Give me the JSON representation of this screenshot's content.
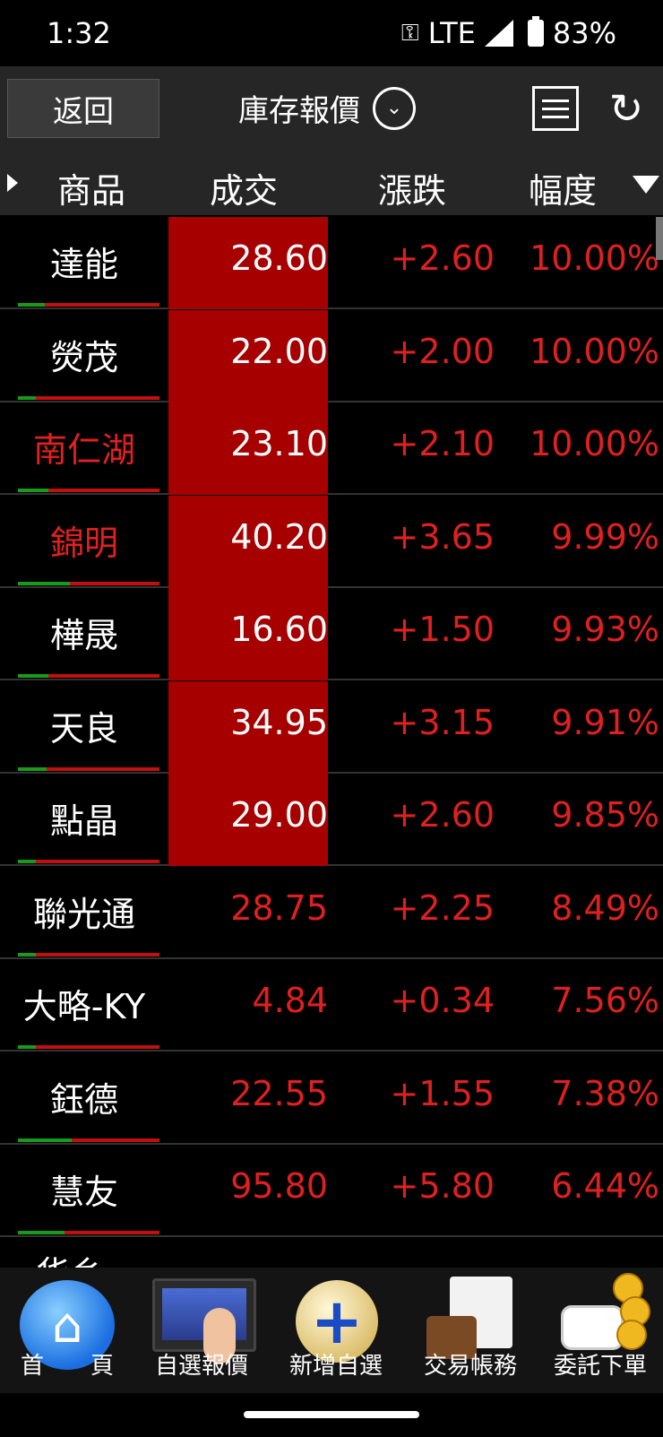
{
  "status_bar": {
    "time": "1:32",
    "network": "LTE",
    "battery": "83%",
    "icons": [
      "vpn-key-icon",
      "signal-icon",
      "battery-icon"
    ]
  },
  "header": {
    "back_label": "返回",
    "title": "庫存報價",
    "icons": [
      "chevron-down-circle-icon",
      "list-icon",
      "refresh-icon"
    ]
  },
  "columns": {
    "product": "商品",
    "price": "成交",
    "change": "漲跌",
    "percent": "幅度"
  },
  "colors": {
    "up_red": "#e02020",
    "limit_up_bg": "#a60000",
    "header_bg": "#262626"
  },
  "rows": [
    {
      "name": "達能",
      "name_color": "#ffffff",
      "price": "28.60",
      "change": "+2.60",
      "percent": "10.00%",
      "limit_up": true
    },
    {
      "name": "熒茂",
      "name_color": "#ffffff",
      "price": "22.00",
      "change": "+2.00",
      "percent": "10.00%",
      "limit_up": true
    },
    {
      "name": "南仁湖",
      "name_color": "#e02020",
      "price": "23.10",
      "change": "+2.10",
      "percent": "10.00%",
      "limit_up": true
    },
    {
      "name": "錦明",
      "name_color": "#e02020",
      "price": "40.20",
      "change": "+3.65",
      "percent": "9.99%",
      "limit_up": true
    },
    {
      "name": "樺晟",
      "name_color": "#ffffff",
      "price": "16.60",
      "change": "+1.50",
      "percent": "9.93%",
      "limit_up": true
    },
    {
      "name": "天良",
      "name_color": "#ffffff",
      "price": "34.95",
      "change": "+3.15",
      "percent": "9.91%",
      "limit_up": true
    },
    {
      "name": "點晶",
      "name_color": "#ffffff",
      "price": "29.00",
      "change": "+2.60",
      "percent": "9.85%",
      "limit_up": true
    },
    {
      "name": "聯光通",
      "name_color": "#ffffff",
      "price": "28.75",
      "change": "+2.25",
      "percent": "8.49%",
      "limit_up": false
    },
    {
      "name": "大略-KY",
      "name_color": "#ffffff",
      "price": "4.84",
      "change": "+0.34",
      "percent": "7.56%",
      "limit_up": false
    },
    {
      "name": "鈺德",
      "name_color": "#ffffff",
      "price": "22.55",
      "change": "+1.55",
      "percent": "7.38%",
      "limit_up": false
    },
    {
      "name": "慧友",
      "name_color": "#ffffff",
      "price": "95.80",
      "change": "+5.80",
      "percent": "6.44%",
      "limit_up": false
    }
  ],
  "partial_row_name": "华乡",
  "bottom_nav": [
    {
      "label": "首　　頁",
      "icon": "home-icon"
    },
    {
      "label": "自選報價",
      "icon": "watchlist-quote-icon"
    },
    {
      "label": "新增自選",
      "icon": "add-icon"
    },
    {
      "label": "交易帳務",
      "icon": "account-icon"
    },
    {
      "label": "委託下單",
      "icon": "order-icon"
    }
  ]
}
